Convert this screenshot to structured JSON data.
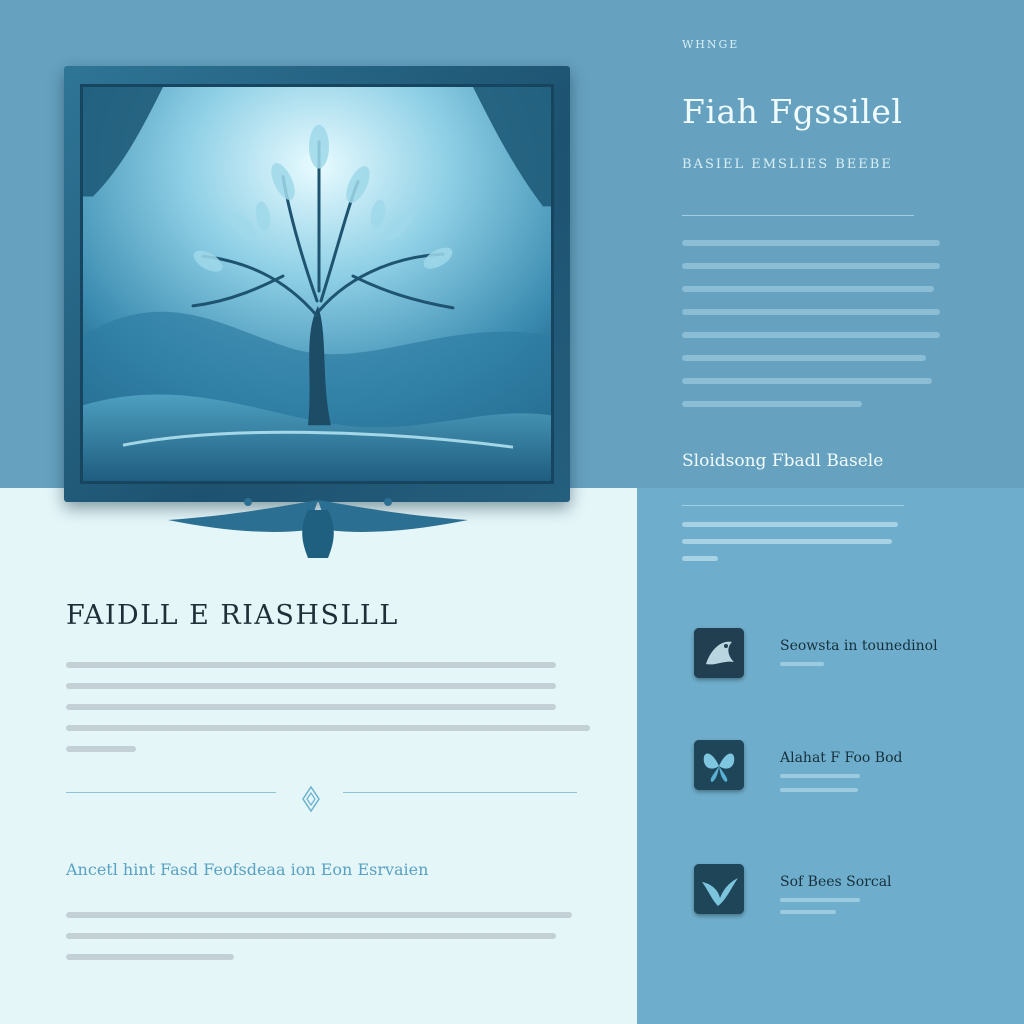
{
  "header": {
    "kicker": "WHNGE",
    "title": "Fiah Fgssilel",
    "tags": "BASIEL  EMSLIES  BEEBE"
  },
  "hero": {
    "image_name": "blue-tree-painting"
  },
  "right": {
    "section_title": "Sloidsong Fbadl Basele",
    "features": [
      {
        "title": "Seowsta in tounedinol",
        "icon": "dragon-icon"
      },
      {
        "title": "Alahat F Foo Bod",
        "icon": "butterfly-icon"
      },
      {
        "title": "Sof Bees Sorcal",
        "icon": "bird-icon"
      }
    ]
  },
  "left": {
    "title": "FAIDLL E RIASHSLLL",
    "subtitle": "Ancetl hint Fasd Feofsdeaa ion Eon Esrvaien",
    "divider_icon": "diamond-ornament-icon"
  },
  "colors": {
    "top_band": "#66a2c0",
    "left_panel": "#e4f6f8",
    "right_panel": "#6eaecc",
    "frame": "#1d5270",
    "accent_text": "#5aa1c2"
  }
}
